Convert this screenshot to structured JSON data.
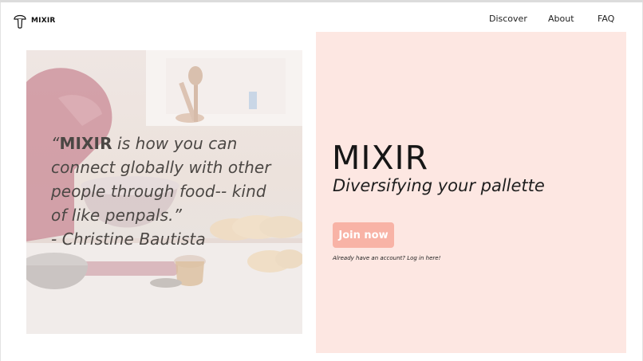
{
  "header": {
    "logo_text": "MIXIR",
    "nav": [
      {
        "label": "Discover"
      },
      {
        "label": "About"
      },
      {
        "label": "FAQ"
      }
    ]
  },
  "hero_image": {
    "quote": {
      "brand": "MIXIR",
      "line1_rest": " is how you can",
      "line2": "connect globally with other",
      "line3": "people through food-- kind",
      "line4": "of like penpals.”",
      "attribution": "- Christine Bautista"
    }
  },
  "hero_panel": {
    "title": "MIXIR",
    "tagline": "Diversifying your pallette",
    "join_button": "Join now",
    "login_link": "Already have an account? Log in here!"
  },
  "colors": {
    "panel_bg": "#fde7e2",
    "button_bg": "#f8b3a6",
    "quote_text": "#4b4744"
  }
}
